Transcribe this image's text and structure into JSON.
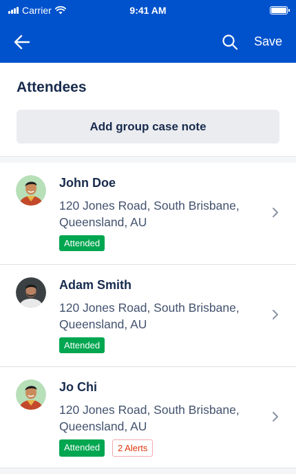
{
  "status": {
    "carrier": "Carrier",
    "time": "9:41 AM"
  },
  "nav": {
    "save_label": "Save"
  },
  "section": {
    "title": "Attendees",
    "add_note_label": "Add group case note"
  },
  "attendees": [
    {
      "name": "John Doe",
      "address": "120 Jones Road, South Brisbane, Queensland, AU",
      "status": "Attended",
      "alerts": ""
    },
    {
      "name": "Adam Smith",
      "address": "120 Jones Road, South Brisbane, Queensland, AU",
      "status": "Attended",
      "alerts": ""
    },
    {
      "name": "Jo Chi",
      "address": "120 Jones Road, South Brisbane, Queensland, AU",
      "status": "Attended",
      "alerts": "2 Alerts"
    }
  ],
  "colors": {
    "header": "#0052cc",
    "attended": "#00a650",
    "alert": "#de350b"
  },
  "icons": {
    "back": "arrow-left-icon",
    "search": "search-icon",
    "chevron": "chevron-right-icon"
  }
}
